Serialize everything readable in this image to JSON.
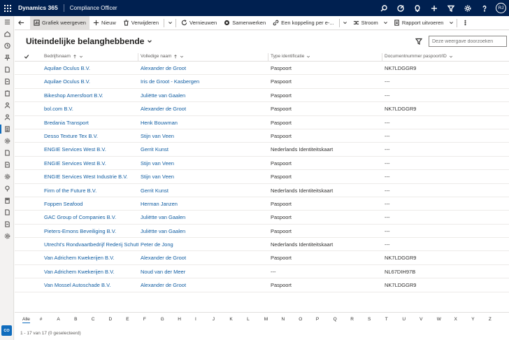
{
  "topbar": {
    "brand": "Dynamics 365",
    "app_name": "Compliance Officer",
    "icons": [
      "search-icon",
      "target-icon",
      "lightbulb-icon",
      "plus-icon",
      "filter-icon",
      "gear-icon",
      "help-icon"
    ],
    "avatar_initials": "RJ"
  },
  "sidebar": {
    "icons": [
      "menu-icon",
      "home-icon",
      "recent-icon",
      "pin-icon",
      "document-icon",
      "document-icon",
      "clipboard-icon",
      "person-icon",
      "person-icon",
      "list-icon",
      "gear-icon",
      "document-icon",
      "document-icon",
      "settings-icon",
      "idea-icon",
      "building-icon",
      "document-icon",
      "document-icon",
      "gear-icon"
    ],
    "badge": "CO"
  },
  "commandbar": {
    "back": "back-icon",
    "show_chart": "Grafiek weergeven",
    "new": "Nieuw",
    "delete": "Verwijderen",
    "refresh": "Vernieuwen",
    "merge": "Samenwerken",
    "share_link": "Een koppeling per e-...",
    "flow": "Stroom",
    "run_report": "Rapport uitvoeren"
  },
  "view": {
    "title": "Uiteindelijke belanghebbende",
    "search_placeholder": "Deze weergave doorzoeken"
  },
  "grid": {
    "columns": [
      "Bedrijfsnaam",
      "Volledige naam",
      "Type identificatie",
      "Documentnummer paspoort/ID"
    ],
    "rows": [
      [
        "Aquilae Oculus B.V.",
        "Alexander de Groot",
        "Paspoort",
        "NK7LDGGR9"
      ],
      [
        "Aquilae Oculus B.V.",
        "Iris de Groot - Kasbergen",
        "Paspoort",
        "---"
      ],
      [
        "Bikeshop Amersfoort B.V.",
        "Juliëtte van Gaalen",
        "Paspoort",
        "---"
      ],
      [
        "bol.com B.V.",
        "Alexander de Groot",
        "Paspoort",
        "NK7LDGGR9"
      ],
      [
        "Bredania Transport",
        "Henk Bouwman",
        "Paspoort",
        "---"
      ],
      [
        "Desso Texture Tex B.V.",
        "Stijn van Veen",
        "Paspoort",
        "---"
      ],
      [
        "ENGIE Services West B.V.",
        "Gerrit Kunst",
        "Nederlands Identiteitskaart",
        "---"
      ],
      [
        "ENGIE Services West B.V.",
        "Stijn van Veen",
        "Paspoort",
        "---"
      ],
      [
        "ENGIE Services West Industrie B.V.",
        "Stijn van Veen",
        "Paspoort",
        "---"
      ],
      [
        "Firm of the Future B.V.",
        "Gerrit Kunst",
        "Nederlands Identiteitskaart",
        "---"
      ],
      [
        "Foppen Seafood",
        "Herman Janzen",
        "Paspoort",
        "---"
      ],
      [
        "GAC Group of Companies B.V.",
        "Juliëtte van Gaalen",
        "Paspoort",
        "---"
      ],
      [
        "Pieters-Emons Beveiliging B.V.",
        "Juliëtte van Gaalen",
        "Paspoort",
        "---"
      ],
      [
        "Utrecht's Rondvaartbedrijf Rederij Schuttevaer",
        "Peter de Jong",
        "Nederlands Identiteitskaart",
        "---"
      ],
      [
        "Van Adrichem Kwekerijen B.V.",
        "Alexander de Groot",
        "Paspoort",
        "NK7LDGGR9"
      ],
      [
        "Van Adrichem Kwekerijen B.V.",
        "Noud van der Meer",
        "---",
        "NL67DIH97B"
      ],
      [
        "Van Mossel Autoschade B.V.",
        "Alexander de Groot",
        "Paspoort",
        "NK7LDGGR9"
      ]
    ]
  },
  "alphabet": [
    "Alle",
    "#",
    "A",
    "B",
    "C",
    "D",
    "E",
    "F",
    "G",
    "H",
    "I",
    "J",
    "K",
    "L",
    "M",
    "N",
    "O",
    "P",
    "Q",
    "R",
    "S",
    "T",
    "U",
    "V",
    "W",
    "X",
    "Y",
    "Z"
  ],
  "footer": {
    "status": "1 - 17 van 17 (0 geselecteerd)"
  }
}
